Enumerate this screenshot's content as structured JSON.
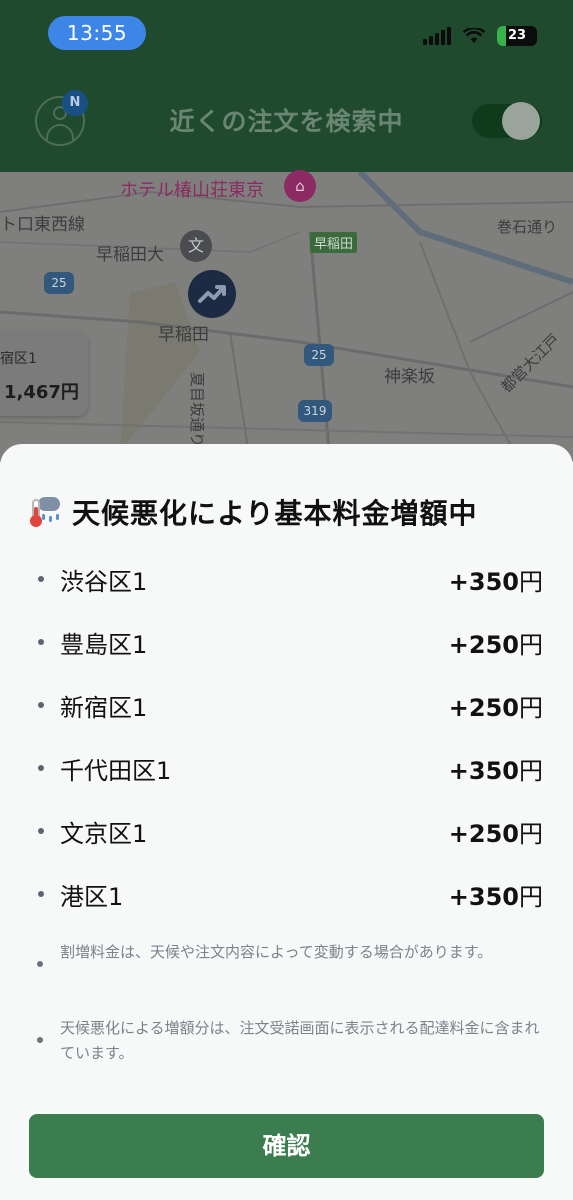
{
  "status_bar": {
    "time": "13:55",
    "battery_level": "23"
  },
  "header": {
    "avatar_badge": "N",
    "title": "近くの注文を検索中",
    "toggle_on": true
  },
  "map": {
    "labels": {
      "hotel": "ホテル椿山荘東京",
      "line": "ト口東西線",
      "wasedadai": "早稲田大",
      "station": "早稲田",
      "waseda": "早稲田",
      "kaguragaka": "神楽坂",
      "makiishi": "巻石通り",
      "natsume": "夏目坂通り",
      "oedo": "都営大江戸",
      "school_glyph": "文"
    },
    "route_shields": [
      "25",
      "25",
      "319"
    ],
    "price_card": {
      "area": "宿区1",
      "amount": "1,467円"
    }
  },
  "sheet": {
    "title": "天候悪化により基本料金増額中",
    "surcharges": [
      {
        "area": "渋谷区1",
        "amount": "+350円"
      },
      {
        "area": "豊島区1",
        "amount": "+250円"
      },
      {
        "area": "新宿区1",
        "amount": "+250円"
      },
      {
        "area": "千代田区1",
        "amount": "+350円"
      },
      {
        "area": "文京区1",
        "amount": "+250円"
      },
      {
        "area": "港区1",
        "amount": "+350円"
      }
    ],
    "notes": [
      "割増料金は、天候や注文内容によって変動する場合があります。",
      "天候悪化による増額分は、注文受諾画面に表示される配達料金に含まれています。"
    ],
    "confirm_label": "確認"
  },
  "colors": {
    "header_bg": "#1f4a2e",
    "time_pill": "#3d86e8",
    "confirm_button": "#3c7d50",
    "sheet_bg": "#f7f8f8"
  }
}
